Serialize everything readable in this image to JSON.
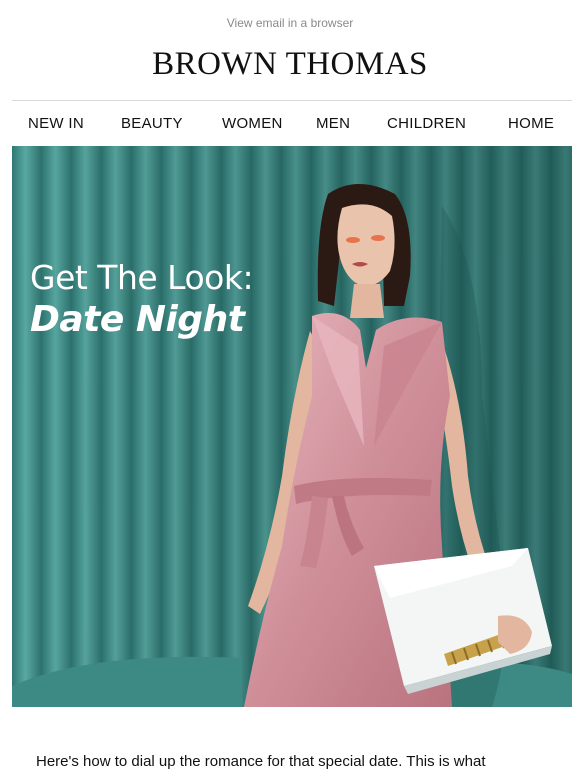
{
  "header": {
    "view_in_browser": "View email in a browser",
    "brand": "BROWN THOMAS"
  },
  "nav": {
    "items": [
      "NEW IN",
      "BEAUTY",
      "WOMEN",
      "MEN",
      "CHILDREN",
      "HOME"
    ]
  },
  "hero": {
    "line1": "Get The Look:",
    "line2": "Date Night",
    "background_color": "#3f8e8a",
    "dress_color": "#d79aa5"
  },
  "body": {
    "intro": "Here's how to dial up the romance for that special date. This is what"
  }
}
